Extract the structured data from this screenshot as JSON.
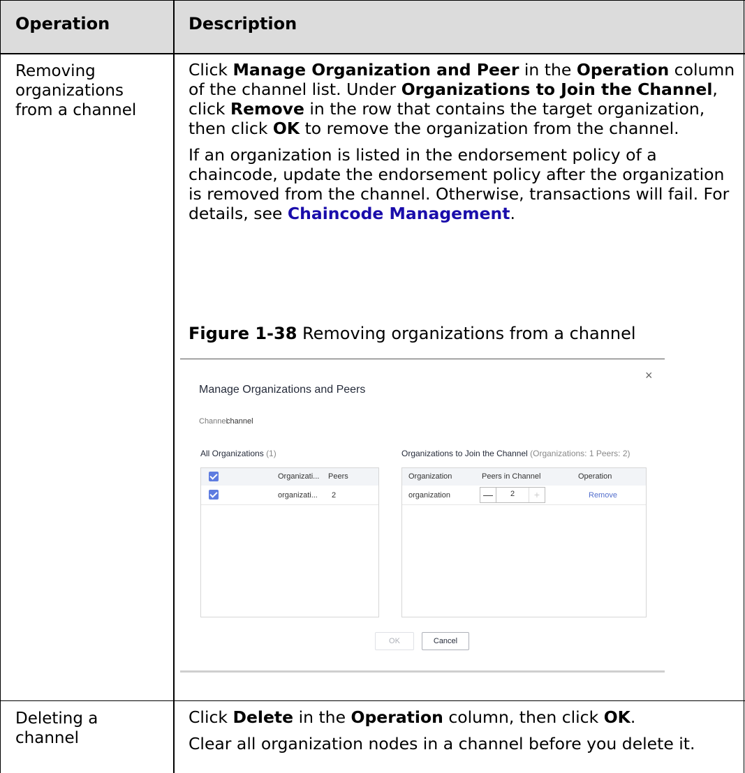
{
  "table": {
    "headers": [
      "Operation",
      "Description"
    ],
    "rows": [
      {
        "operation": "Removing organizations from a channel",
        "description_p1": {
          "t1": "Click ",
          "b1": "Manage Organization and Peer",
          "t2": " in the ",
          "b2": "Operation",
          "t3": " column of the channel list. Under ",
          "b3": "Organizations to Join the Channel",
          "t4": ", click ",
          "b4": "Remove",
          "t5": " in the row that contains the target organization, then click ",
          "b5": "OK",
          "t6": " to remove the organization from the channel."
        },
        "description_p2": {
          "t1": "If an organization is listed in the endorsement policy of a chaincode, update the endorsement policy after the organization is removed from the channel. Otherwise, transactions will fail. For details, see ",
          "link": "Chaincode Management",
          "t2": "."
        },
        "figure_label": "Figure 1-38",
        "figure_caption": " Removing organizations from a channel"
      },
      {
        "operation": "Deleting a channel",
        "description_p1": {
          "t1": "Click ",
          "b1": "Delete",
          "t2": " in the ",
          "b2": "Operation",
          "t3": " column, then click ",
          "b3": "OK",
          "t4": "."
        },
        "description_p2": "Clear all organization nodes in a channel before you delete it."
      }
    ]
  },
  "dialog": {
    "title": "Manage Organizations and Peers",
    "close_icon": "×",
    "channel_label": "Channel",
    "channel_value": "channel",
    "all_orgs": {
      "title": "All Organizations",
      "count": "(1)",
      "col_org": "Organizati...",
      "col_peers": "Peers",
      "row_org": "organizati...",
      "row_peers": "2"
    },
    "join_orgs": {
      "title": "Organizations to Join the Channel",
      "summary": "(Organizations: 1 Peers: 2)",
      "col_org": "Organization",
      "col_peers": "Peers in Channel",
      "col_op": "Operation",
      "row_org": "organization",
      "stepper_minus": "—",
      "stepper_value": "2",
      "stepper_plus": "+",
      "row_action": "Remove"
    },
    "ok_label": "OK",
    "cancel_label": "Cancel",
    "accent_color": "#5e7ce0"
  }
}
